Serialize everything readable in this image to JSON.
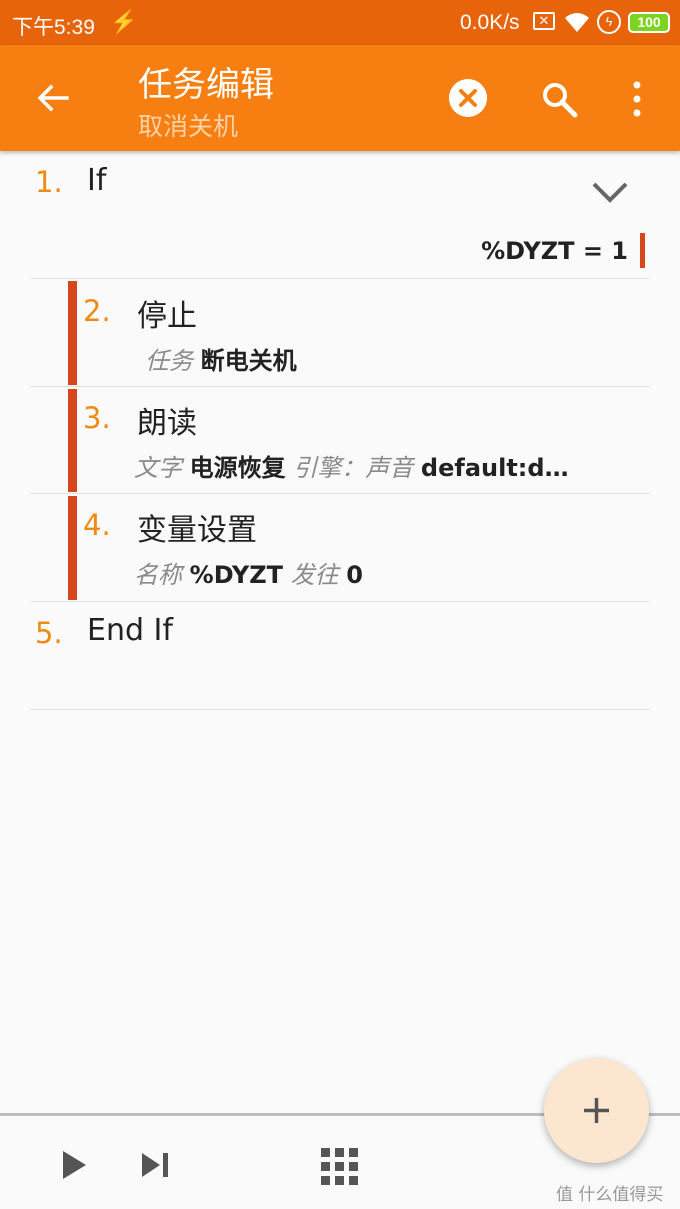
{
  "statusbar": {
    "time": "下午5:39",
    "speed": "0.0K/s",
    "battery": "100",
    "icons": [
      "bolt-icon",
      "sim-x-icon",
      "wifi-icon",
      "charging-icon",
      "battery-icon"
    ]
  },
  "appbar": {
    "title": "任务编辑",
    "subtitle": "取消关机",
    "icons": [
      "back-arrow-icon",
      "clear-icon",
      "search-icon",
      "more-vert-icon"
    ]
  },
  "actions": [
    {
      "num": "1.",
      "name": "If",
      "condition": "%DYZT = 1"
    },
    {
      "num": "2.",
      "name": "停止",
      "params": [
        {
          "k": "任务",
          "v": "断电关机"
        }
      ]
    },
    {
      "num": "3.",
      "name": "朗读",
      "params": [
        {
          "k": "文字",
          "v": "电源恢复"
        },
        {
          "k": "引擎：声音",
          "v": "default:d…"
        }
      ]
    },
    {
      "num": "4.",
      "name": "变量设置",
      "params": [
        {
          "k": "名称",
          "v": "%DYZT"
        },
        {
          "k": "发往",
          "v": "0"
        }
      ]
    },
    {
      "num": "5.",
      "name": "End If"
    }
  ],
  "bottombar": {
    "icons": [
      "play-icon",
      "step-icon",
      "grid-icon",
      "add-icon"
    ]
  },
  "watermark": "值 什么值得买",
  "colors": {
    "statusbar": "#e8640a",
    "appbar": "#f77f12",
    "accent_number": "#ef8a12",
    "indent_bar": "#d6461d",
    "fab": "#fde6cf"
  }
}
